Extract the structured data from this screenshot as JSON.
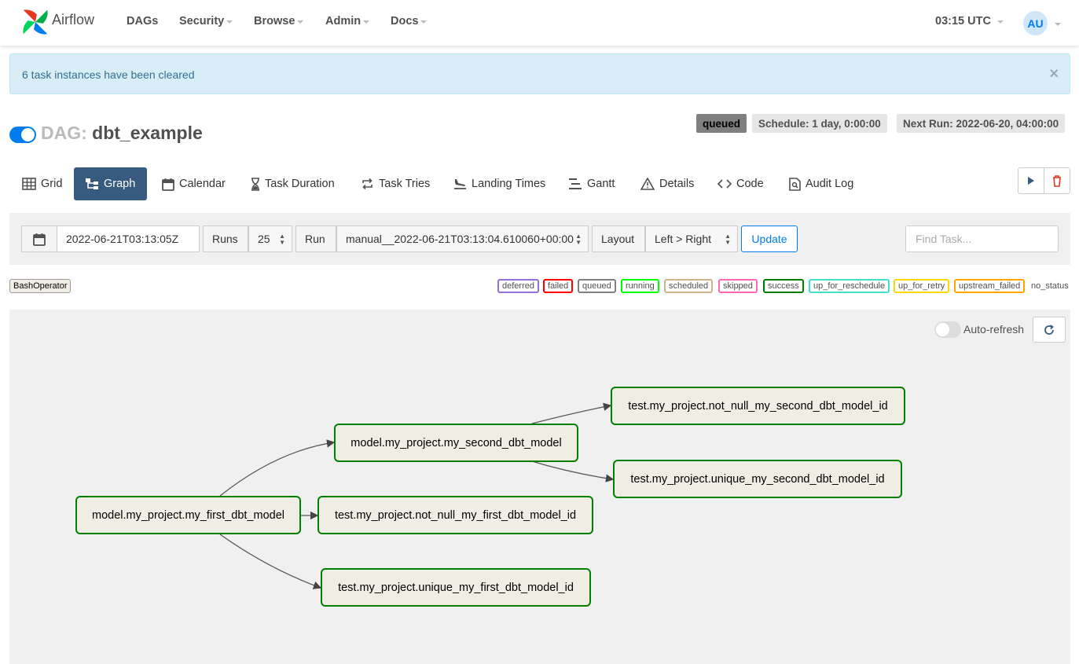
{
  "navbar": {
    "brand": "Airflow",
    "items": [
      "DAGs",
      "Security",
      "Browse",
      "Admin",
      "Docs"
    ],
    "time": "03:15 UTC",
    "avatar": "AU"
  },
  "alert": {
    "message": "6 task instances have been cleared",
    "close": "×"
  },
  "dag": {
    "prefix": "DAG:",
    "name": "dbt_example",
    "state": "queued",
    "schedule": "Schedule: 1 day, 0:00:00",
    "next_run": "Next Run: 2022-06-20, 04:00:00"
  },
  "tabs": [
    {
      "label": "Grid",
      "icon": "grid-icon"
    },
    {
      "label": "Graph",
      "icon": "graph-icon"
    },
    {
      "label": "Calendar",
      "icon": "calendar-icon"
    },
    {
      "label": "Task Duration",
      "icon": "hourglass-icon"
    },
    {
      "label": "Task Tries",
      "icon": "repeat-icon"
    },
    {
      "label": "Landing Times",
      "icon": "landing-icon"
    },
    {
      "label": "Gantt",
      "icon": "gantt-icon"
    },
    {
      "label": "Details",
      "icon": "warning-icon"
    },
    {
      "label": "Code",
      "icon": "code-icon"
    },
    {
      "label": "Audit Log",
      "icon": "audit-log-icon"
    }
  ],
  "controls": {
    "date": "2022-06-21T03:13:05Z",
    "runs_label": "Runs",
    "runs_value": "25",
    "run_label": "Run",
    "run_value": "manual__2022-06-21T03:13:04.610060+00:00",
    "layout_label": "Layout",
    "layout_value": "Left > Right",
    "update": "Update",
    "find_placeholder": "Find Task..."
  },
  "legend": {
    "operator": "BashOperator",
    "states": [
      {
        "name": "deferred",
        "color": "#9370db"
      },
      {
        "name": "failed",
        "color": "#ff0000"
      },
      {
        "name": "queued",
        "color": "#808080"
      },
      {
        "name": "running",
        "color": "#00ff00"
      },
      {
        "name": "scheduled",
        "color": "#d2b48c"
      },
      {
        "name": "skipped",
        "color": "#ff69b4"
      },
      {
        "name": "success",
        "color": "#008000"
      },
      {
        "name": "up_for_reschedule",
        "color": "#40e0d0"
      },
      {
        "name": "up_for_retry",
        "color": "#ffd700"
      },
      {
        "name": "upstream_failed",
        "color": "#ffa500"
      },
      {
        "name": "no_status",
        "color": "#ffffff"
      }
    ]
  },
  "graph": {
    "auto_refresh": "Auto-refresh",
    "nodes": [
      "model.my_project.my_first_dbt_model",
      "model.my_project.my_second_dbt_model",
      "test.my_project.not_null_my_first_dbt_model_id",
      "test.my_project.unique_my_first_dbt_model_id",
      "test.my_project.not_null_my_second_dbt_model_id",
      "test.my_project.unique_my_second_dbt_model_id"
    ],
    "edges": [
      [
        0,
        1
      ],
      [
        0,
        2
      ],
      [
        0,
        3
      ],
      [
        1,
        4
      ],
      [
        1,
        5
      ]
    ]
  },
  "colors": {
    "accent": "#017cee",
    "active_tab": "#375a7f",
    "node_border": "#008000",
    "node_fill": "#f0ede4"
  }
}
